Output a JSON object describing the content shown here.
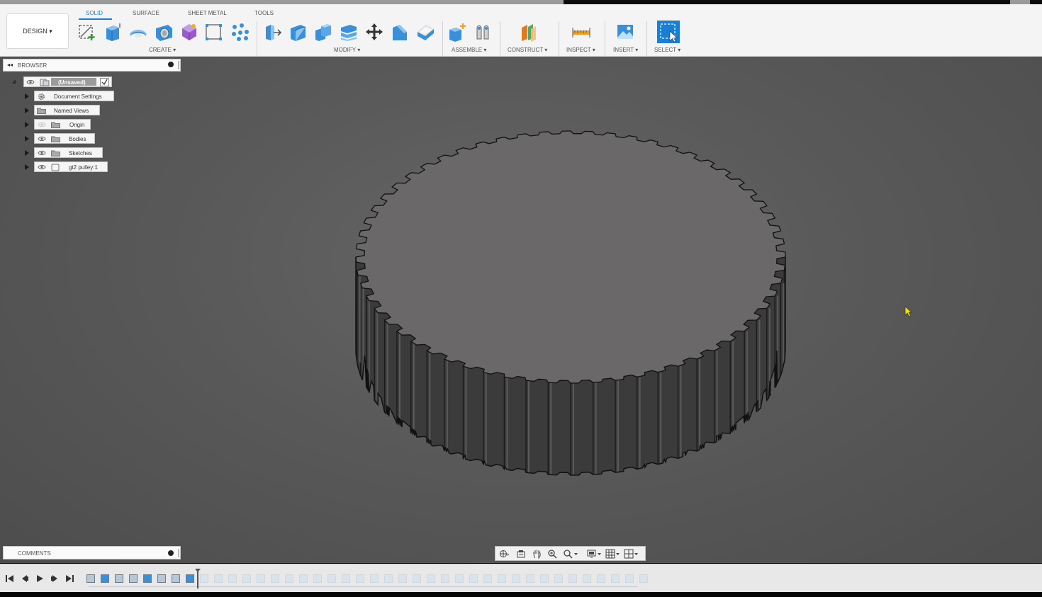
{
  "app": {
    "workspace_label": "DESIGN ▾"
  },
  "ribbon": {
    "tabs": [
      "SOLID",
      "SURFACE",
      "SHEET METAL",
      "TOOLS"
    ],
    "active_tab": "SOLID",
    "groups": [
      "CREATE ▾",
      "MODIFY ▾",
      "ASSEMBLE ▾",
      "CONSTRUCT ▾",
      "INSPECT ▾",
      "INSERT ▾",
      "SELECT ▾"
    ],
    "tools": [
      "create-sketch-icon",
      "extrude-icon",
      "revolve-icon",
      "hole-icon",
      "form-icon",
      "rectangular-pattern-icon",
      "pattern-points-icon",
      "press-pull-icon",
      "fillet-icon",
      "combine-icon",
      "offset-face-icon",
      "move-icon",
      "chamfer-icon",
      "shell-icon",
      "new-component-icon",
      "joint-icon",
      "offset-plane-icon",
      "measure-icon",
      "insert-image-icon",
      "select-icon"
    ]
  },
  "browser": {
    "title": "BROWSER",
    "root": {
      "label": "(Unsaved)"
    },
    "items": [
      {
        "label": "Document Settings",
        "icon": "gear-icon"
      },
      {
        "label": "Named Views",
        "icon": "folder-icon"
      },
      {
        "label": "Origin",
        "icon": "folder-icon"
      },
      {
        "label": "Bodies",
        "icon": "folder-icon"
      },
      {
        "label": "Sketches",
        "icon": "folder-icon"
      },
      {
        "label": "gt2 pulley:1",
        "icon": "component-icon"
      }
    ]
  },
  "comments": {
    "title": "COMMENTS"
  },
  "viewport": {
    "model": "gt2-pulley-body",
    "cursor_color": "#f2e600"
  },
  "navbar": {
    "tools": [
      "orbit-icon",
      "look-at-icon",
      "pan-icon",
      "zoom-icon",
      "fit-icon",
      "display-settings-icon",
      "grid-icon",
      "viewports-icon"
    ]
  },
  "timeline": {
    "controls": [
      "first-icon",
      "previous-icon",
      "play-icon",
      "next-icon",
      "last-icon"
    ]
  },
  "colors": {
    "accent": "#1a7fd4",
    "viewport_bg": "#5a5a5a",
    "model_top": "#6a6868",
    "model_side": "#3b3b3b"
  }
}
